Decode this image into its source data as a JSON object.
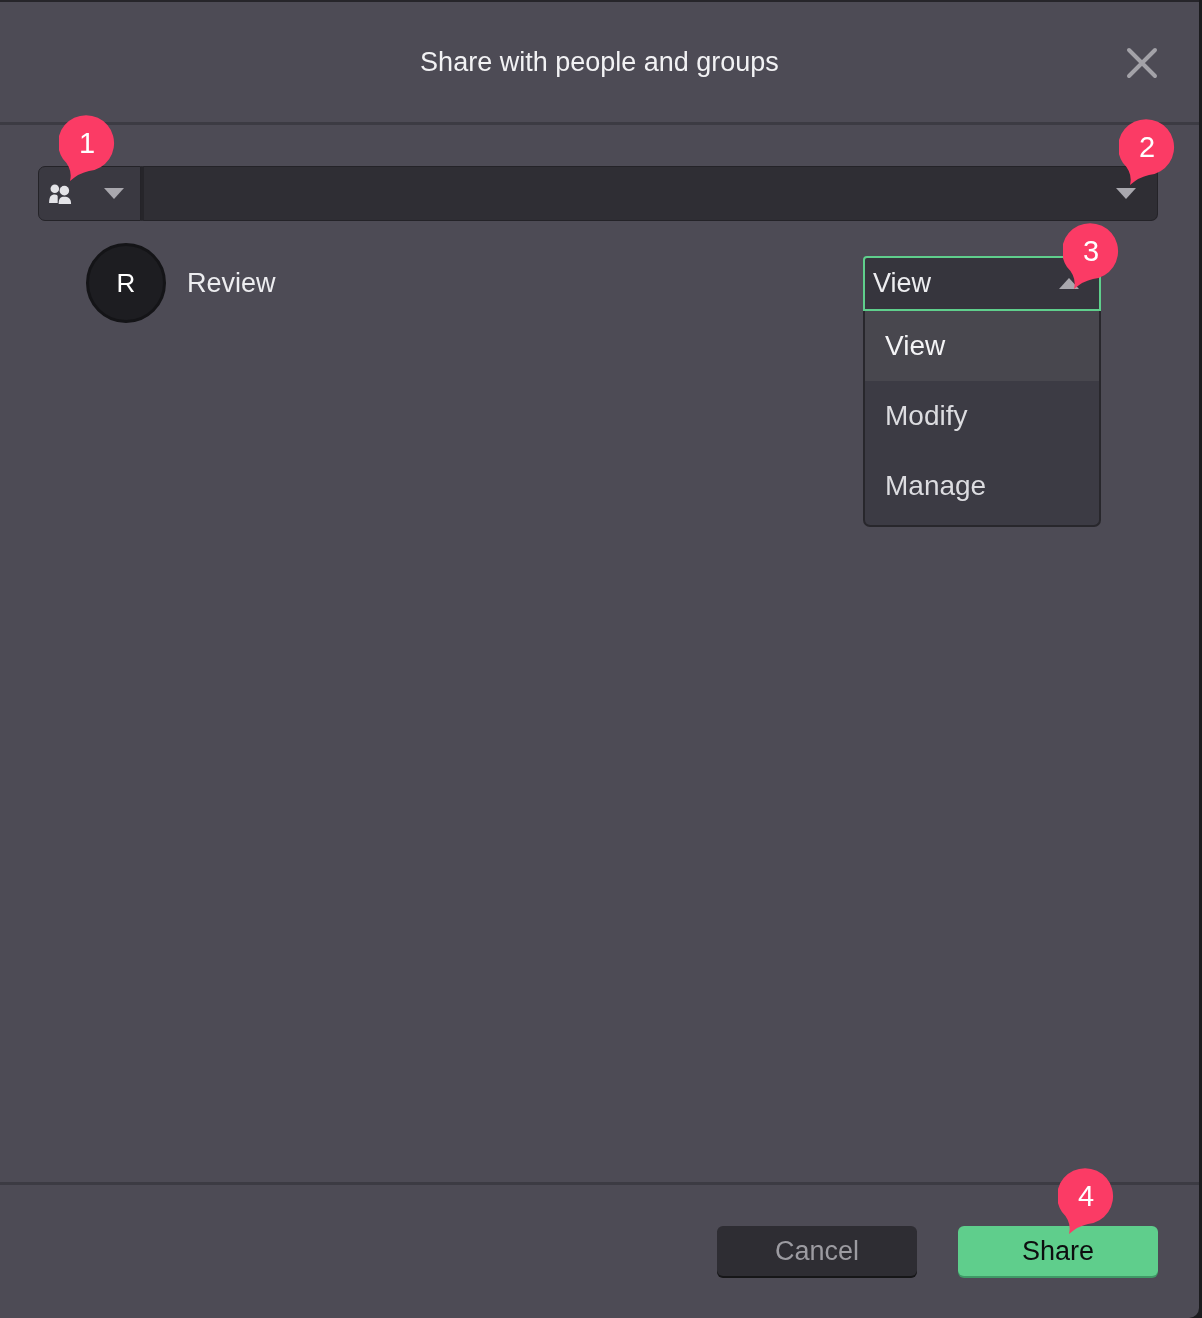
{
  "dialog": {
    "title": "Share with people and groups"
  },
  "recipient_picker": {
    "type_menu": {
      "expanded": false,
      "callout": "1"
    },
    "field": {
      "expanded": false,
      "callout": "2"
    }
  },
  "shared_with": [
    {
      "initial": "R",
      "name": "Review",
      "permission": {
        "value": "View",
        "expanded": true,
        "callout": "3",
        "options": [
          {
            "label": "View",
            "selected": true
          },
          {
            "label": "Modify",
            "selected": false
          },
          {
            "label": "Manage",
            "selected": false
          }
        ]
      }
    }
  ],
  "buttons": [
    {
      "kind": "secondary",
      "label": "Cancel"
    },
    {
      "kind": "primary",
      "label": "Share",
      "callout": "4"
    }
  ]
}
